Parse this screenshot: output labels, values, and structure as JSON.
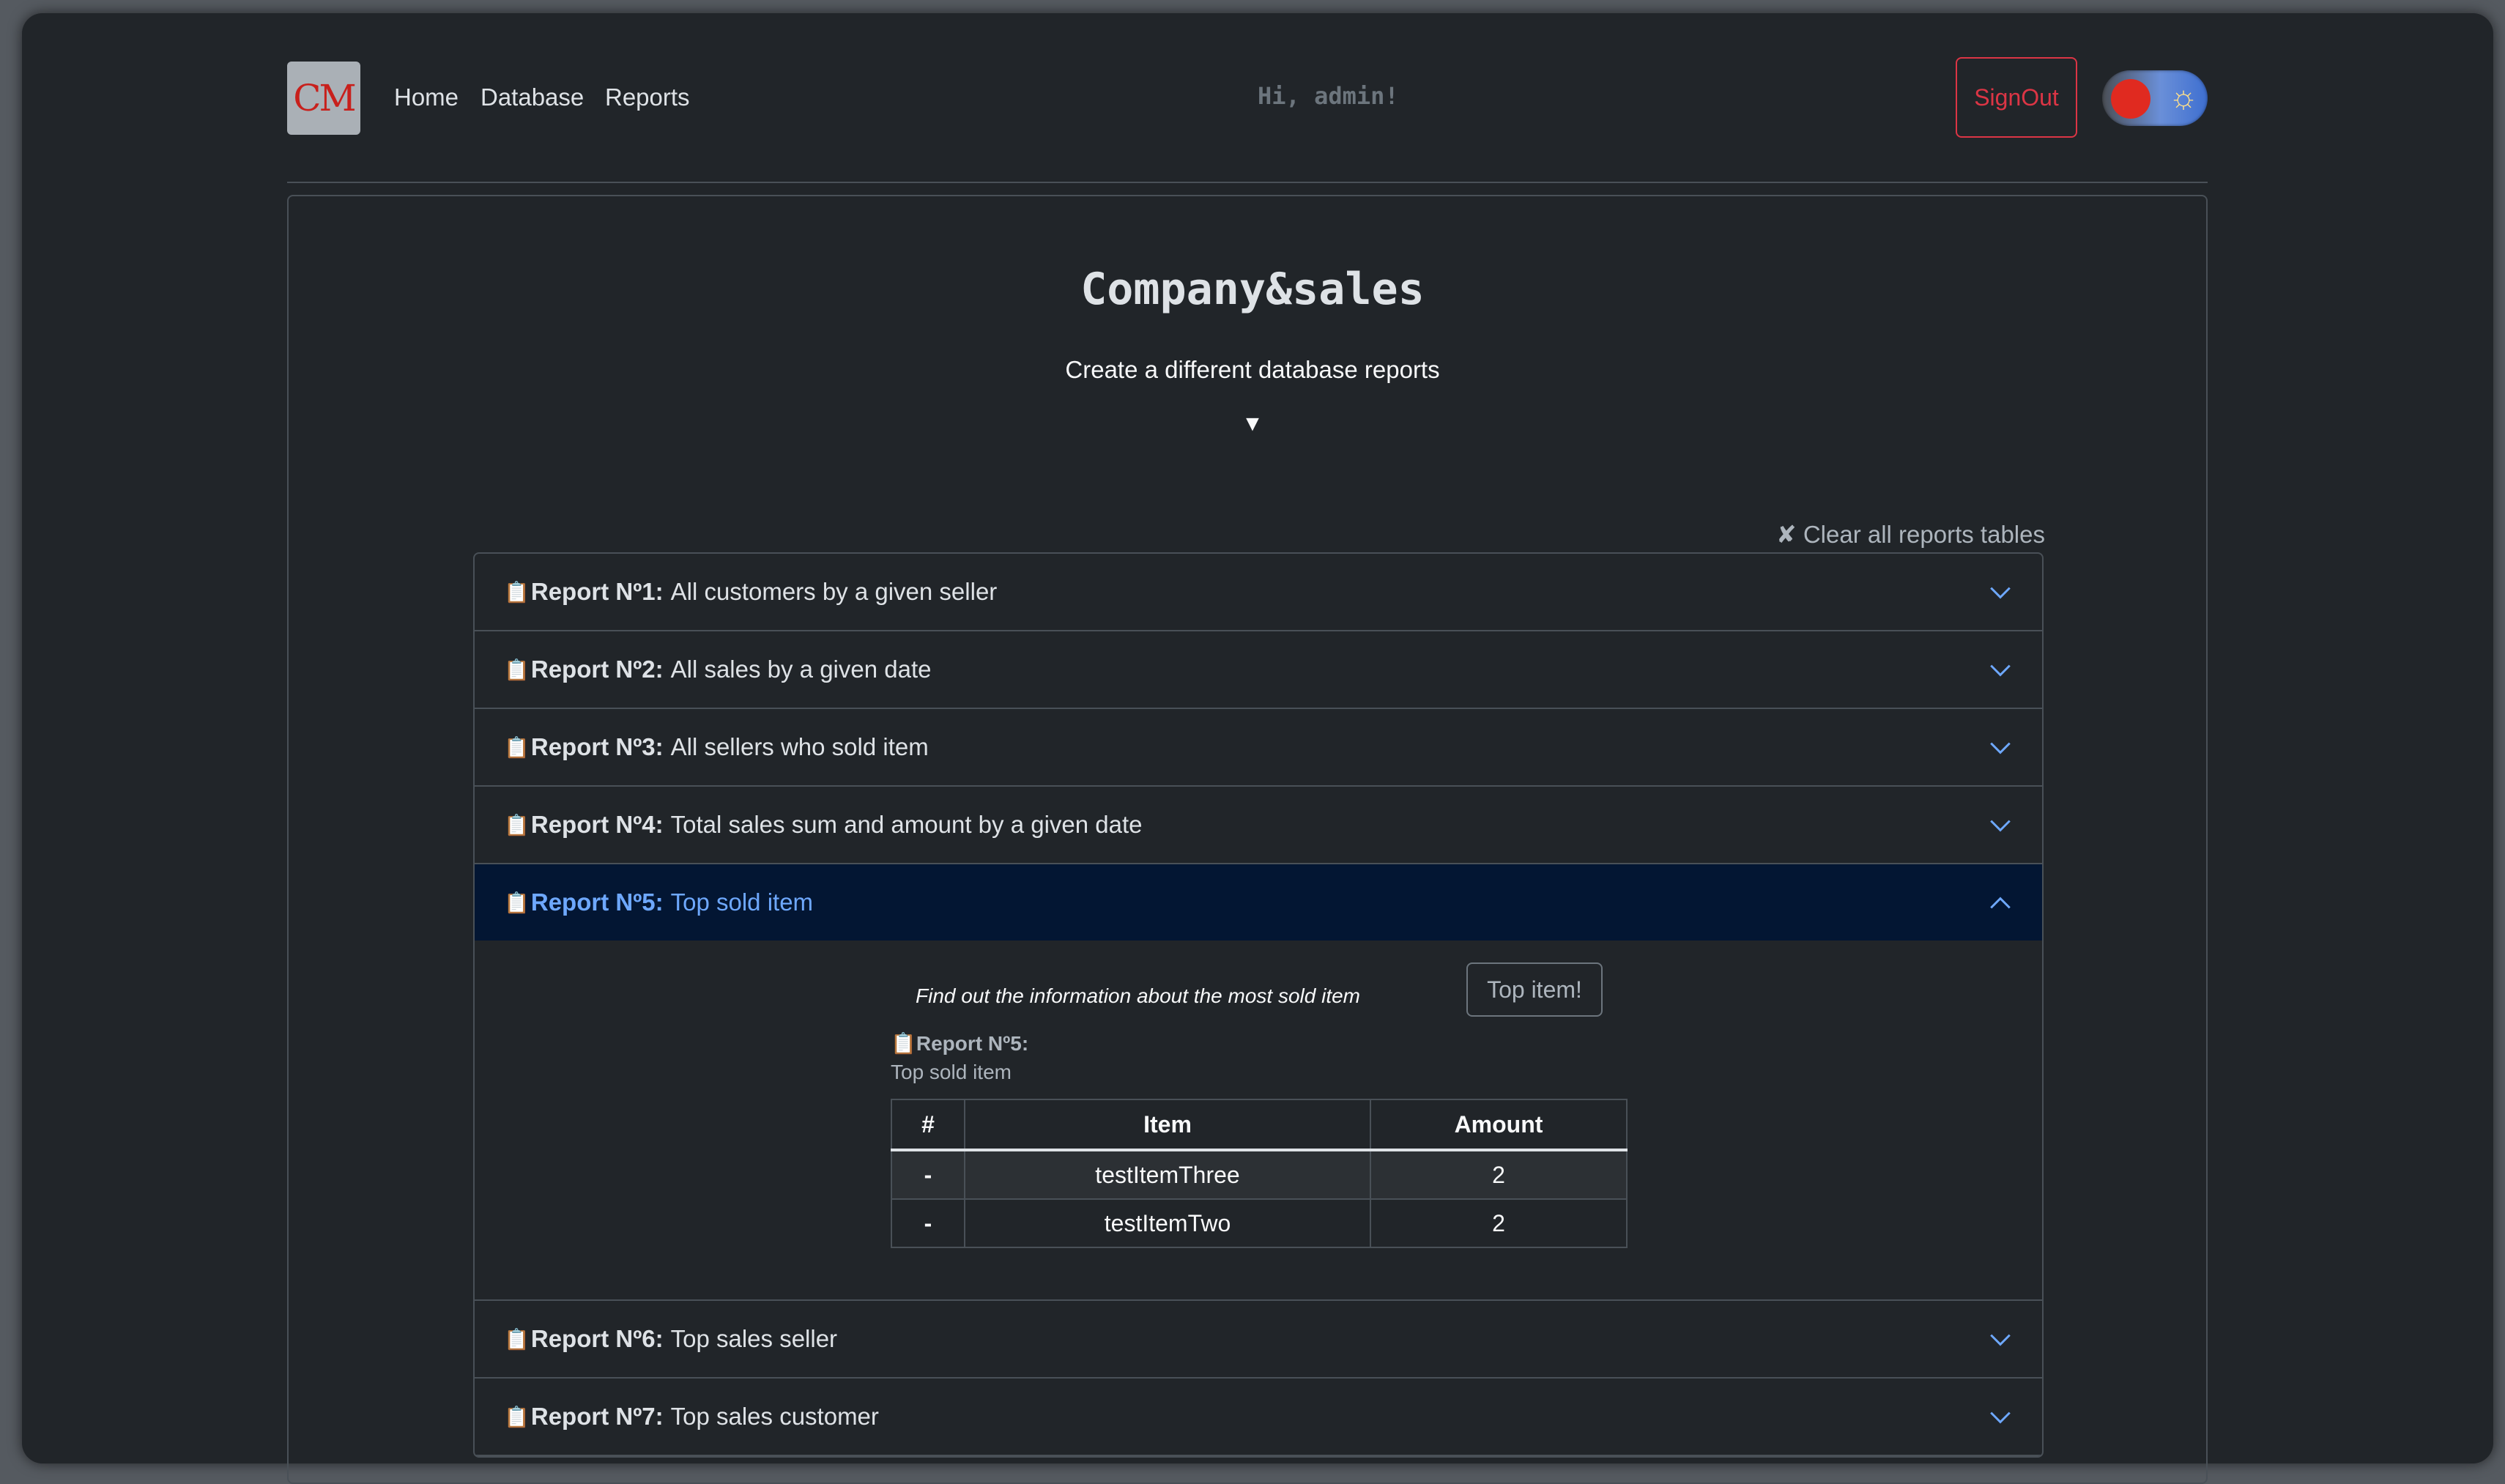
{
  "nav": {
    "logo": "CM",
    "links": [
      "Home",
      "Database",
      "Reports"
    ],
    "greeting": "Hi, admin!",
    "signout": "SignOut"
  },
  "hero": {
    "title": "Company&sales",
    "subtitle": "Create a different database reports",
    "arrow": "▼"
  },
  "clear_label": "✘ Clear all reports tables",
  "reports": [
    {
      "num": "Report Nº1:",
      "label": "All customers by a given seller"
    },
    {
      "num": "Report Nº2:",
      "label": "All sales by a given date"
    },
    {
      "num": "Report Nº3:",
      "label": "All sellers who sold item"
    },
    {
      "num": "Report Nº4:",
      "label": "Total sales sum and amount by a given date"
    },
    {
      "num": "Report Nº5:",
      "label": "Top sold item"
    },
    {
      "num": "Report Nº6:",
      "label": "Top sales seller"
    },
    {
      "num": "Report Nº7:",
      "label": "Top sales customer"
    }
  ],
  "report5": {
    "find_text": "Find out the information about the most sold item",
    "button": "Top item!",
    "result_title": "📋Report Nº5:",
    "result_subtitle": "Top sold item",
    "columns": [
      "#",
      "Item",
      "Amount"
    ],
    "rows": [
      {
        "num": "-",
        "item": "testItemThree",
        "amount": "2"
      },
      {
        "num": "-",
        "item": "testItemTwo",
        "amount": "2"
      }
    ]
  },
  "colors": {
    "accent": "#6ea8fe",
    "danger": "#dc3545",
    "bg": "#212529",
    "active_header": "#031633"
  }
}
